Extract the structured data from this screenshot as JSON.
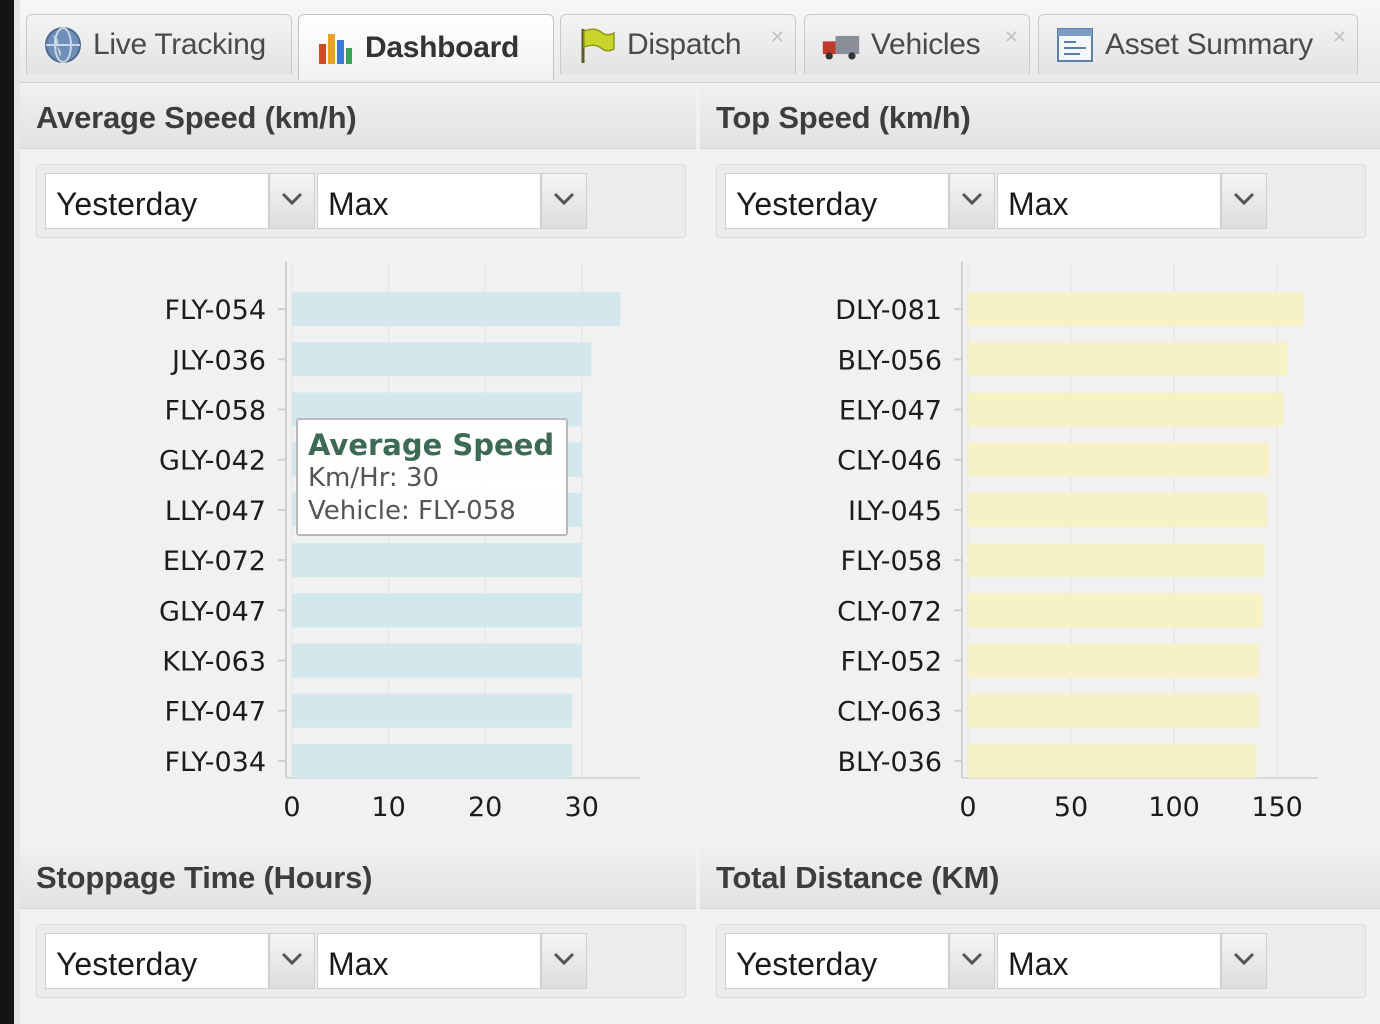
{
  "tabs": [
    {
      "label": "Live Tracking",
      "icon": "globe-icon",
      "active": false,
      "closable": false
    },
    {
      "label": "Dashboard",
      "icon": "bar-chart-icon",
      "active": true,
      "closable": false
    },
    {
      "label": "Dispatch",
      "icon": "flag-icon",
      "active": false,
      "closable": true
    },
    {
      "label": "Vehicles",
      "icon": "truck-icon",
      "active": false,
      "closable": true
    },
    {
      "label": "Asset Summary",
      "icon": "report-icon",
      "active": false,
      "closable": true
    }
  ],
  "panels": {
    "avg_speed": {
      "title": "Average Speed (km/h)",
      "period": "Yesterday",
      "metric": "Max"
    },
    "top_speed": {
      "title": "Top Speed (km/h)",
      "period": "Yesterday",
      "metric": "Max"
    },
    "stoppage": {
      "title": "Stoppage Time (Hours)",
      "period": "Yesterday",
      "metric": "Max"
    },
    "distance": {
      "title": "Total Distance (KM)",
      "period": "Yesterday",
      "metric": "Max"
    }
  },
  "tooltip": {
    "title": "Average Speed",
    "line1": "Km/Hr: 30",
    "line2": "Vehicle: FLY-058"
  },
  "colors": {
    "avg_bar": "#d3e8ec",
    "top_bar": "#f7f1c6",
    "tooltip_title": "#3d6a55"
  },
  "chart_data": [
    {
      "type": "bar",
      "orientation": "horizontal",
      "title": "Average Speed (km/h)",
      "categories": [
        "FLY-054",
        "JLY-036",
        "FLY-058",
        "GLY-042",
        "LLY-047",
        "ELY-072",
        "GLY-047",
        "KLY-063",
        "FLY-047",
        "FLY-034"
      ],
      "values": [
        34,
        31,
        30,
        30,
        30,
        30,
        30,
        30,
        29,
        29
      ],
      "xlim": [
        0,
        35
      ],
      "ticks": [
        0,
        10,
        20,
        30
      ]
    },
    {
      "type": "bar",
      "orientation": "horizontal",
      "title": "Top Speed (km/h)",
      "categories": [
        "DLY-081",
        "BLY-056",
        "ELY-047",
        "CLY-046",
        "ILY-045",
        "FLY-058",
        "CLY-072",
        "FLY-052",
        "CLY-063",
        "BLY-036"
      ],
      "values": [
        163,
        155,
        153,
        146,
        145,
        144,
        143,
        141,
        141,
        140
      ],
      "xlim": [
        0,
        165
      ],
      "ticks": [
        0,
        50,
        100,
        150
      ]
    }
  ]
}
